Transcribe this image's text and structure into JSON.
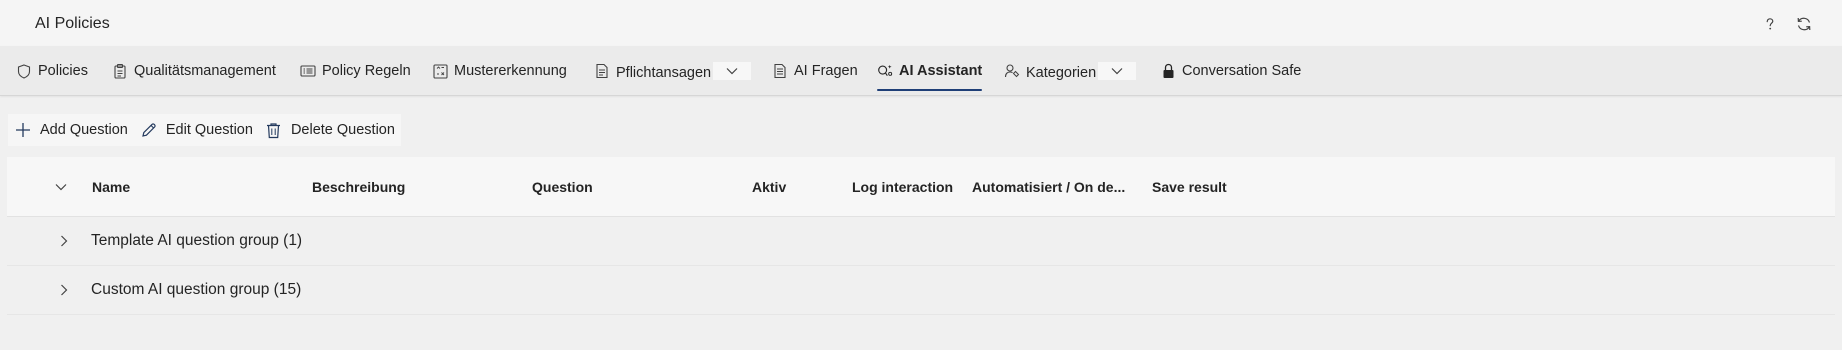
{
  "app": {
    "title": "AI Policies"
  },
  "titlebar": {
    "icons": [
      "help-icon",
      "refresh-icon"
    ]
  },
  "tabs": [
    {
      "label": "Policies",
      "icon": "shield-icon"
    },
    {
      "label": "Qualitätsmanagement",
      "icon": "clipboard-icon"
    },
    {
      "label": "Policy Regeln",
      "icon": "rules-icon"
    },
    {
      "label": "Mustererkennung",
      "icon": "pattern-icon"
    },
    {
      "label": "Pflichtansagen",
      "icon": "document-icon",
      "dropdown": true
    },
    {
      "label": "AI Fragen",
      "icon": "document-lines-icon"
    },
    {
      "label": "AI Assistant",
      "icon": "assistant-icon",
      "active": true
    },
    {
      "label": "Kategorien",
      "icon": "person-tag-icon",
      "dropdown": true
    },
    {
      "label": "Conversation Safe",
      "icon": "lock-icon"
    }
  ],
  "commands": [
    {
      "label": "Add Question",
      "icon": "plus-icon"
    },
    {
      "label": "Edit Question",
      "icon": "pencil-icon"
    },
    {
      "label": "Delete Question",
      "icon": "trash-icon"
    }
  ],
  "grid": {
    "columns": [
      "Name",
      "Beschreibung",
      "Question",
      "Aktiv",
      "Log interaction",
      "Automatisiert / On de...",
      "Save result"
    ],
    "groups": [
      {
        "label": "Template AI question group (1)"
      },
      {
        "label": "Custom AI question group (15)"
      }
    ]
  },
  "colors": {
    "accent": "#1f3f77",
    "background": "#f0f0f0",
    "text": "#242424"
  }
}
